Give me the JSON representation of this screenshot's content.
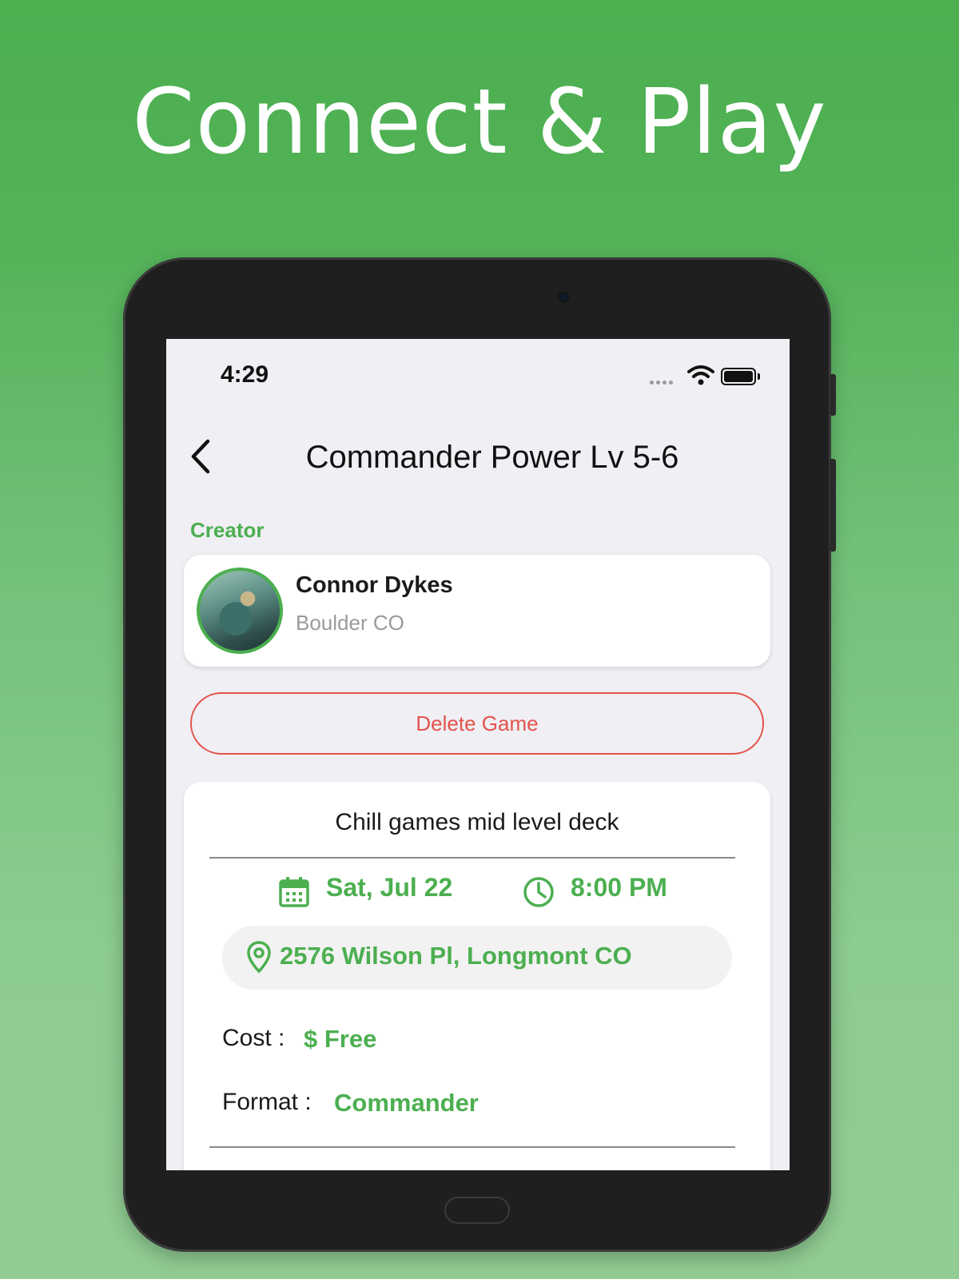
{
  "headline": "Connect & Play",
  "status_bar": {
    "time": "4:29"
  },
  "nav": {
    "title": "Commander Power Lv 5-6",
    "back_icon": "chevron-left-icon"
  },
  "creator_section": {
    "label": "Creator",
    "name": "Connor Dykes",
    "location": "Boulder CO"
  },
  "delete_button": {
    "label": "Delete Game"
  },
  "game": {
    "description": "Chill games mid level deck",
    "date": "Sat, Jul 22",
    "time": "8:00 PM",
    "address": "2576 Wilson Pl, Longmont CO",
    "cost_label": "Cost :",
    "cost_value": "$ Free",
    "format_label": "Format :",
    "format_value": "Commander"
  },
  "colors": {
    "accent": "#4caf50",
    "danger": "#e5534b",
    "background_top": "#4caf50",
    "background_bottom": "#91cd93"
  }
}
